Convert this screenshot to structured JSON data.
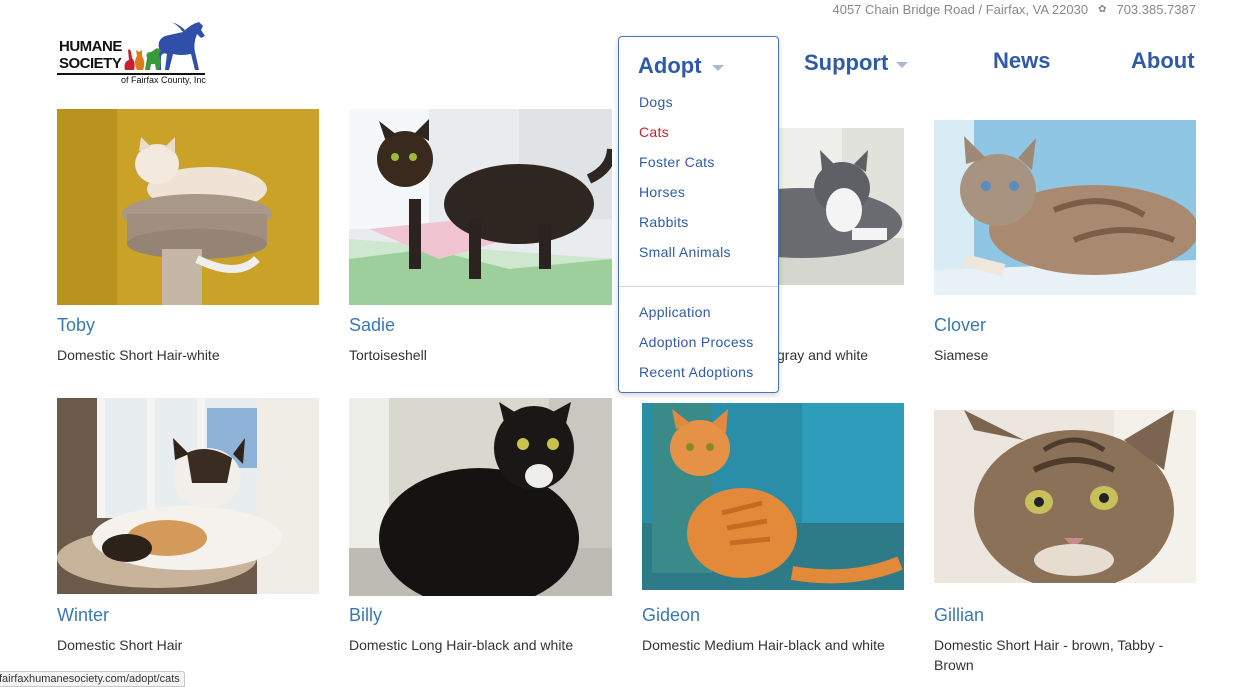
{
  "contact": {
    "address": "4057 Chain Bridge Road / Fairfax, VA 22030",
    "phone": "703.385.7387",
    "paw_icon": "paw-icon"
  },
  "logo": {
    "line1": "HUMANE",
    "line2": "SOCIETY",
    "line3": "of Fairfax County, Inc"
  },
  "nav": {
    "adopt": "Adopt",
    "support": "Support",
    "news": "News",
    "about": "About"
  },
  "dropdown": {
    "title": "Adopt",
    "animals": [
      {
        "label": "Dogs",
        "active": false
      },
      {
        "label": "Cats",
        "active": true
      },
      {
        "label": "Foster Cats",
        "active": false
      },
      {
        "label": "Horses",
        "active": false
      },
      {
        "label": "Rabbits",
        "active": false
      },
      {
        "label": "Small Animals",
        "active": false
      }
    ],
    "info": [
      "Application",
      "Adoption Process",
      "Recent Adoptions"
    ]
  },
  "cats": [
    {
      "name": "Toby",
      "breed": "Domestic Short Hair-white"
    },
    {
      "name": "Sadie",
      "breed": "Tortoiseshell"
    },
    {
      "name": "",
      "breed": "gray and white"
    },
    {
      "name": "Clover",
      "breed": "Siamese"
    },
    {
      "name": "Winter",
      "breed": "Domestic Short Hair"
    },
    {
      "name": "Billy",
      "breed": "Domestic Long Hair-black and white"
    },
    {
      "name": "Gideon",
      "breed": "Domestic Medium Hair-black and white"
    },
    {
      "name": "Gillian",
      "breed": "Domestic Short Hair - brown, Tabby - Brown"
    }
  ],
  "status_url": "fairfaxhumanesociety.com/adopt/cats",
  "colors": {
    "nav_blue": "#2f5aa8",
    "link_blue": "#3a78b5",
    "active_red": "#c8202f"
  }
}
